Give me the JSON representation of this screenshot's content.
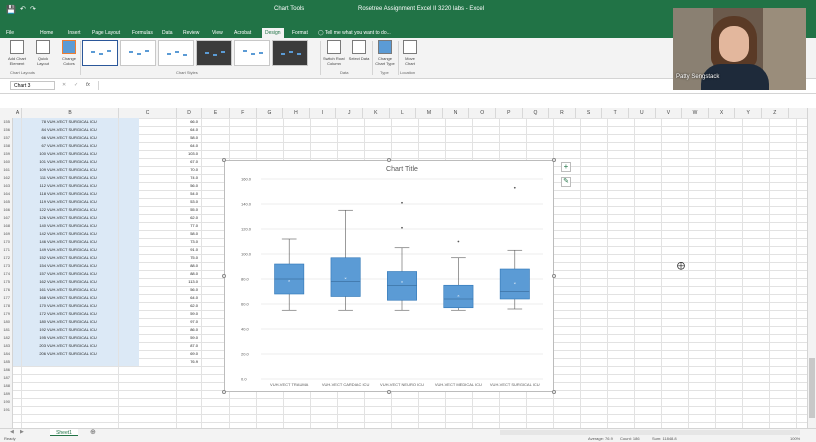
{
  "window": {
    "title": "Rosetree Assignment Excel II 3220 labs - Excel",
    "context_tab": "Chart Tools",
    "search_hint": "Tell me what you want to do..."
  },
  "ribbon_tabs": [
    {
      "label": "File"
    },
    {
      "label": "Home"
    },
    {
      "label": "Insert"
    },
    {
      "label": "Page Layout"
    },
    {
      "label": "Formulas"
    },
    {
      "label": "Data"
    },
    {
      "label": "Review"
    },
    {
      "label": "View"
    },
    {
      "label": "Acrobat"
    },
    {
      "label": "Design",
      "active": true
    },
    {
      "label": "Format"
    }
  ],
  "ribbon": {
    "add_chart_element": "Add Chart Element",
    "quick_layout": "Quick Layout",
    "change_colors": "Change Colors",
    "group_chart_layouts": "Chart Layouts",
    "group_chart_styles": "Chart Styles",
    "switch_row_col": "Switch Row/ Column",
    "select_data": "Select Data",
    "group_data": "Data",
    "change_chart_type": "Change Chart Type",
    "group_type": "Type",
    "move_chart": "Move Chart",
    "group_location": "Location"
  },
  "formula_bar": {
    "name_box": "Chart 3",
    "fx": "fx",
    "value": ""
  },
  "columns": [
    "A",
    "B",
    "C",
    "D",
    "E",
    "F",
    "G",
    "H",
    "I",
    "J",
    "K",
    "L",
    "M",
    "N",
    "O",
    "P",
    "Q",
    "R",
    "S",
    "T",
    "U",
    "V",
    "W",
    "X",
    "Y",
    "Z"
  ],
  "rows": [
    {
      "n": "155",
      "a": "78",
      "b": "VUH-VECT SURGICAL ICU",
      "c": "66.0"
    },
    {
      "n": "156",
      "a": "84",
      "b": "VUH-VECT SURGICAL ICU",
      "c": "64.0"
    },
    {
      "n": "157",
      "c": "58.0",
      "b": "VUH-VECT SURGICAL ICU",
      "a": "66"
    },
    {
      "n": "158",
      "a": "67",
      "b": "VUH-VECT SURGICAL ICU",
      "c": "64.0"
    },
    {
      "n": "159",
      "a": "100",
      "b": "VUH-VECT SURGICAL ICU",
      "c": "103.0"
    },
    {
      "n": "160",
      "a": "101",
      "b": "VUH-VECT SURGICAL ICU",
      "c": "67.0"
    },
    {
      "n": "161",
      "a": "109",
      "b": "VUH-VECT SURGICAL ICU",
      "c": "70.0"
    },
    {
      "n": "162",
      "a": "111",
      "b": "VUH-VECT SURGICAL ICU",
      "c": "74.0"
    },
    {
      "n": "163",
      "a": "112",
      "b": "VUH-VECT SURGICAL ICU",
      "c": "56.0"
    },
    {
      "n": "164",
      "a": "118",
      "b": "VUH-VECT SURGICAL ICU",
      "c": "54.0"
    },
    {
      "n": "165",
      "a": "119",
      "b": "VUH-VECT SURGICAL ICU",
      "c": "53.0"
    },
    {
      "n": "166",
      "a": "122",
      "b": "VUH-VECT SURGICAL ICU",
      "c": "55.0"
    },
    {
      "n": "167",
      "a": "126",
      "b": "VUH-VECT SURGICAL ICU",
      "c": "62.0"
    },
    {
      "n": "168",
      "a": "140",
      "b": "VUH-VECT SURGICAL ICU",
      "c": "77.0"
    },
    {
      "n": "169",
      "a": "142",
      "b": "VUH-VECT SURGICAL ICU",
      "c": "58.0"
    },
    {
      "n": "170",
      "a": "146",
      "b": "VUH-VECT SURGICAL ICU",
      "c": "73.0"
    },
    {
      "n": "171",
      "a": "149",
      "b": "VUH-VECT SURGICAL ICU",
      "c": "91.0"
    },
    {
      "n": "172",
      "a": "152",
      "b": "VUH-VECT SURGICAL ICU",
      "c": "75.0"
    },
    {
      "n": "173",
      "a": "154",
      "b": "VUH-VECT SURGICAL ICU",
      "c": "88.0"
    },
    {
      "n": "174",
      "a": "157",
      "b": "VUH-VECT SURGICAL ICU",
      "c": "88.0"
    },
    {
      "n": "175",
      "a": "162",
      "b": "VUH-VECT SURGICAL ICU",
      "c": "113.0"
    },
    {
      "n": "176",
      "a": "161",
      "b": "VUH-VECT SURGICAL ICU",
      "c": "56.0"
    },
    {
      "n": "177",
      "a": "168",
      "b": "VUH-VECT SURGICAL ICU",
      "c": "64.0"
    },
    {
      "n": "178",
      "a": "170",
      "b": "VUH-VECT SURGICAL ICU",
      "c": "62.0"
    },
    {
      "n": "179",
      "a": "172",
      "b": "VUH-VECT SURGICAL ICU",
      "c": "59.0"
    },
    {
      "n": "180",
      "a": "180",
      "b": "VUH-VECT SURGICAL ICU",
      "c": "97.0"
    },
    {
      "n": "181",
      "a": "192",
      "b": "VUH-VECT SURGICAL ICU",
      "c": "86.0"
    },
    {
      "n": "182",
      "a": "195",
      "b": "VUH-VECT SURGICAL ICU",
      "c": "59.0"
    },
    {
      "n": "183",
      "a": "203",
      "b": "VUH-VECT SURGICAL ICU",
      "c": "87.0"
    },
    {
      "n": "184",
      "a": "206",
      "b": "VUH-VECT SURGICAL ICU",
      "c": "69.0"
    },
    {
      "n": "185",
      "a": "",
      "b": "",
      "c": "76.9"
    },
    {
      "n": "186",
      "a": "",
      "b": "",
      "c": ""
    },
    {
      "n": "187",
      "a": "",
      "b": "",
      "c": ""
    },
    {
      "n": "188",
      "a": "",
      "b": "",
      "c": ""
    },
    {
      "n": "189",
      "a": "",
      "b": "",
      "c": ""
    },
    {
      "n": "190",
      "a": "",
      "b": "",
      "c": ""
    },
    {
      "n": "191",
      "a": "",
      "b": "",
      "c": ""
    }
  ],
  "sheet_tab": "Sheet1",
  "status": {
    "left": "Ready",
    "average": "Average: 76.9",
    "count": "Count: 186",
    "sum": "Sum: 11848.8",
    "zoom": "100%"
  },
  "webcam": {
    "name": "Patty Sengstack"
  },
  "colors": {
    "excel_green": "#217346",
    "box_fill": "#5b9bd5",
    "box_stroke": "#2e75b6"
  },
  "chart_data": {
    "type": "box",
    "title": "Chart Title",
    "ylim": [
      0,
      160
    ],
    "yticks": [
      0,
      20,
      40,
      60,
      80,
      100,
      120,
      140,
      160
    ],
    "categories": [
      "VUH-VECT TRAUMA",
      "VUH-VECT CARDIAC ICU",
      "VUH-VECT NEURO ICU",
      "VUH-VECT MEDICAL ICU",
      "VUH-VECT SURGICAL ICU"
    ],
    "boxes": [
      {
        "min": 55,
        "q1": 68,
        "median": 80,
        "q3": 92,
        "max": 112,
        "mean": 79,
        "outliers": []
      },
      {
        "min": 55,
        "q1": 66,
        "median": 78,
        "q3": 97,
        "max": 135,
        "mean": 81,
        "outliers": []
      },
      {
        "min": 55,
        "q1": 63,
        "median": 75,
        "q3": 86,
        "max": 105,
        "mean": 78,
        "outliers": [
          121,
          141
        ]
      },
      {
        "min": 55,
        "q1": 57,
        "median": 64,
        "q3": 75,
        "max": 97,
        "mean": 67,
        "outliers": [
          110
        ]
      },
      {
        "min": 56,
        "q1": 64,
        "median": 70,
        "q3": 88,
        "max": 103,
        "mean": 77,
        "outliers": [
          153
        ]
      }
    ],
    "grid": true,
    "legend": "none"
  }
}
